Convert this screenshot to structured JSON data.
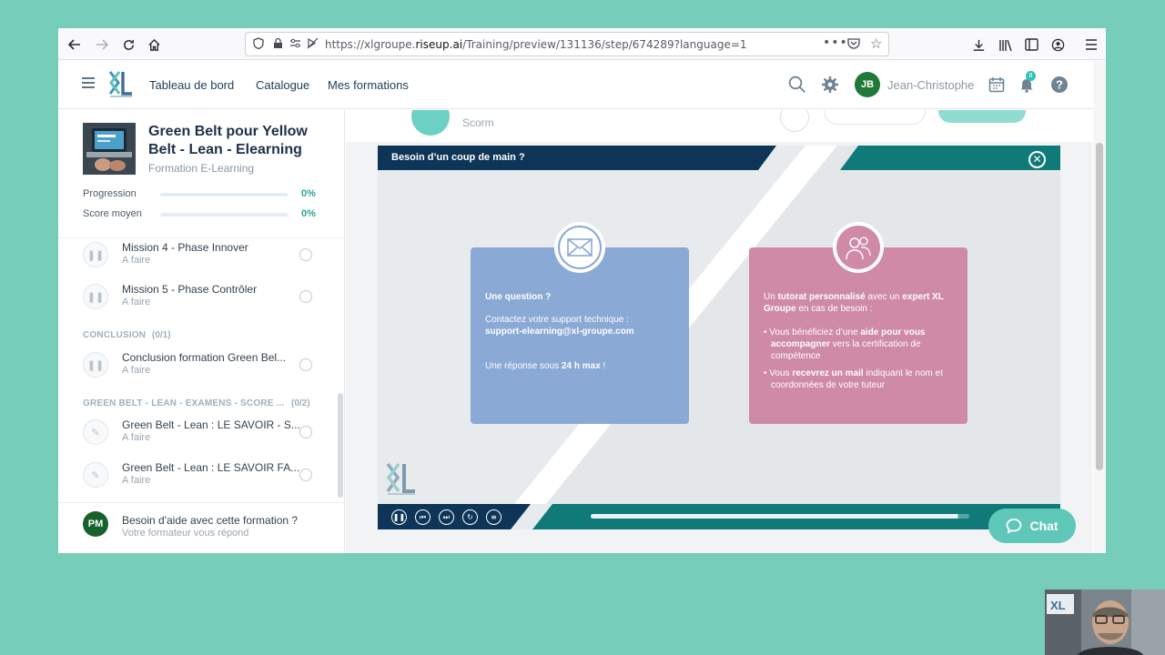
{
  "browser": {
    "url_prefix": "https://xlgroupe.",
    "url_domain": "riseup.ai",
    "url_path": "/Training/preview/131136/step/674289?language=1"
  },
  "header": {
    "nav": [
      "Tableau de bord",
      "Catalogue",
      "Mes formations"
    ],
    "user_initials": "JB",
    "user_name": "Jean-Christophe",
    "notification_count": "8"
  },
  "course": {
    "title": "Green Belt pour Yellow Belt - Lean - Elearning",
    "subtitle": "Formation E-Learning",
    "progress_label": "Progression",
    "progress_value": "0%",
    "score_label": "Score moyen",
    "score_value": "0%"
  },
  "steps": [
    {
      "title": "Mission 4 - Phase Innover",
      "status": "A faire"
    },
    {
      "title": "Mission 5 - Phase Contrôler",
      "status": "A faire"
    },
    {
      "title": "Conclusion formation Green Bel...",
      "status": "A faire"
    },
    {
      "title": "Green Belt - Lean : LE SAVOIR - S...",
      "status": "A faire"
    },
    {
      "title": "Green Belt - Lean : LE SAVOIR FA...",
      "status": "A faire"
    }
  ],
  "sections": [
    {
      "title": "CONCLUSION",
      "count": "(0/1)"
    },
    {
      "title": "GREEN BELT - LEAN - EXAMENS - SCORE ...",
      "count": "(0/2)"
    }
  ],
  "help": {
    "initials": "PM",
    "title": "Besoin d'aide avec cette formation ?",
    "subtitle": "Votre formateur vous répond"
  },
  "content": {
    "type_label": "Scorm"
  },
  "player": {
    "title": "Besoin d’un coup de main ?",
    "blue_card": {
      "heading": "Une question ?",
      "line1": "Contactez votre support technique :",
      "email": "support-elearning@xl-groupe.com",
      "response_prefix": "Une réponse sous ",
      "response_bold": "24 h max",
      "response_suffix": " !"
    },
    "pink_card": {
      "p1_a": "Un ",
      "p1_b": "tutorat personnalisé",
      "p1_c": " avec un ",
      "p1_d": "expert XL Groupe",
      "p1_e": " en cas de besoin :",
      "b1_a": "Vous bénéficiez d’une ",
      "b1_b": "aide pour vous accompagner",
      "b1_c": " vers la certification de compétence",
      "b2_a": "Vous ",
      "b2_b": "recevrez un mail",
      "b2_c": " indiquant le nom et coordonnées de votre tuteur"
    },
    "progress": 0.97
  },
  "chat_label": "Chat",
  "colors": {
    "background": "#76cdb9",
    "accent": "#2aa69a",
    "player_navy": "#0e3557",
    "player_teal": "#0f7a78",
    "card_blue": "#8ba9d5",
    "card_pink": "#cf8aa8"
  }
}
